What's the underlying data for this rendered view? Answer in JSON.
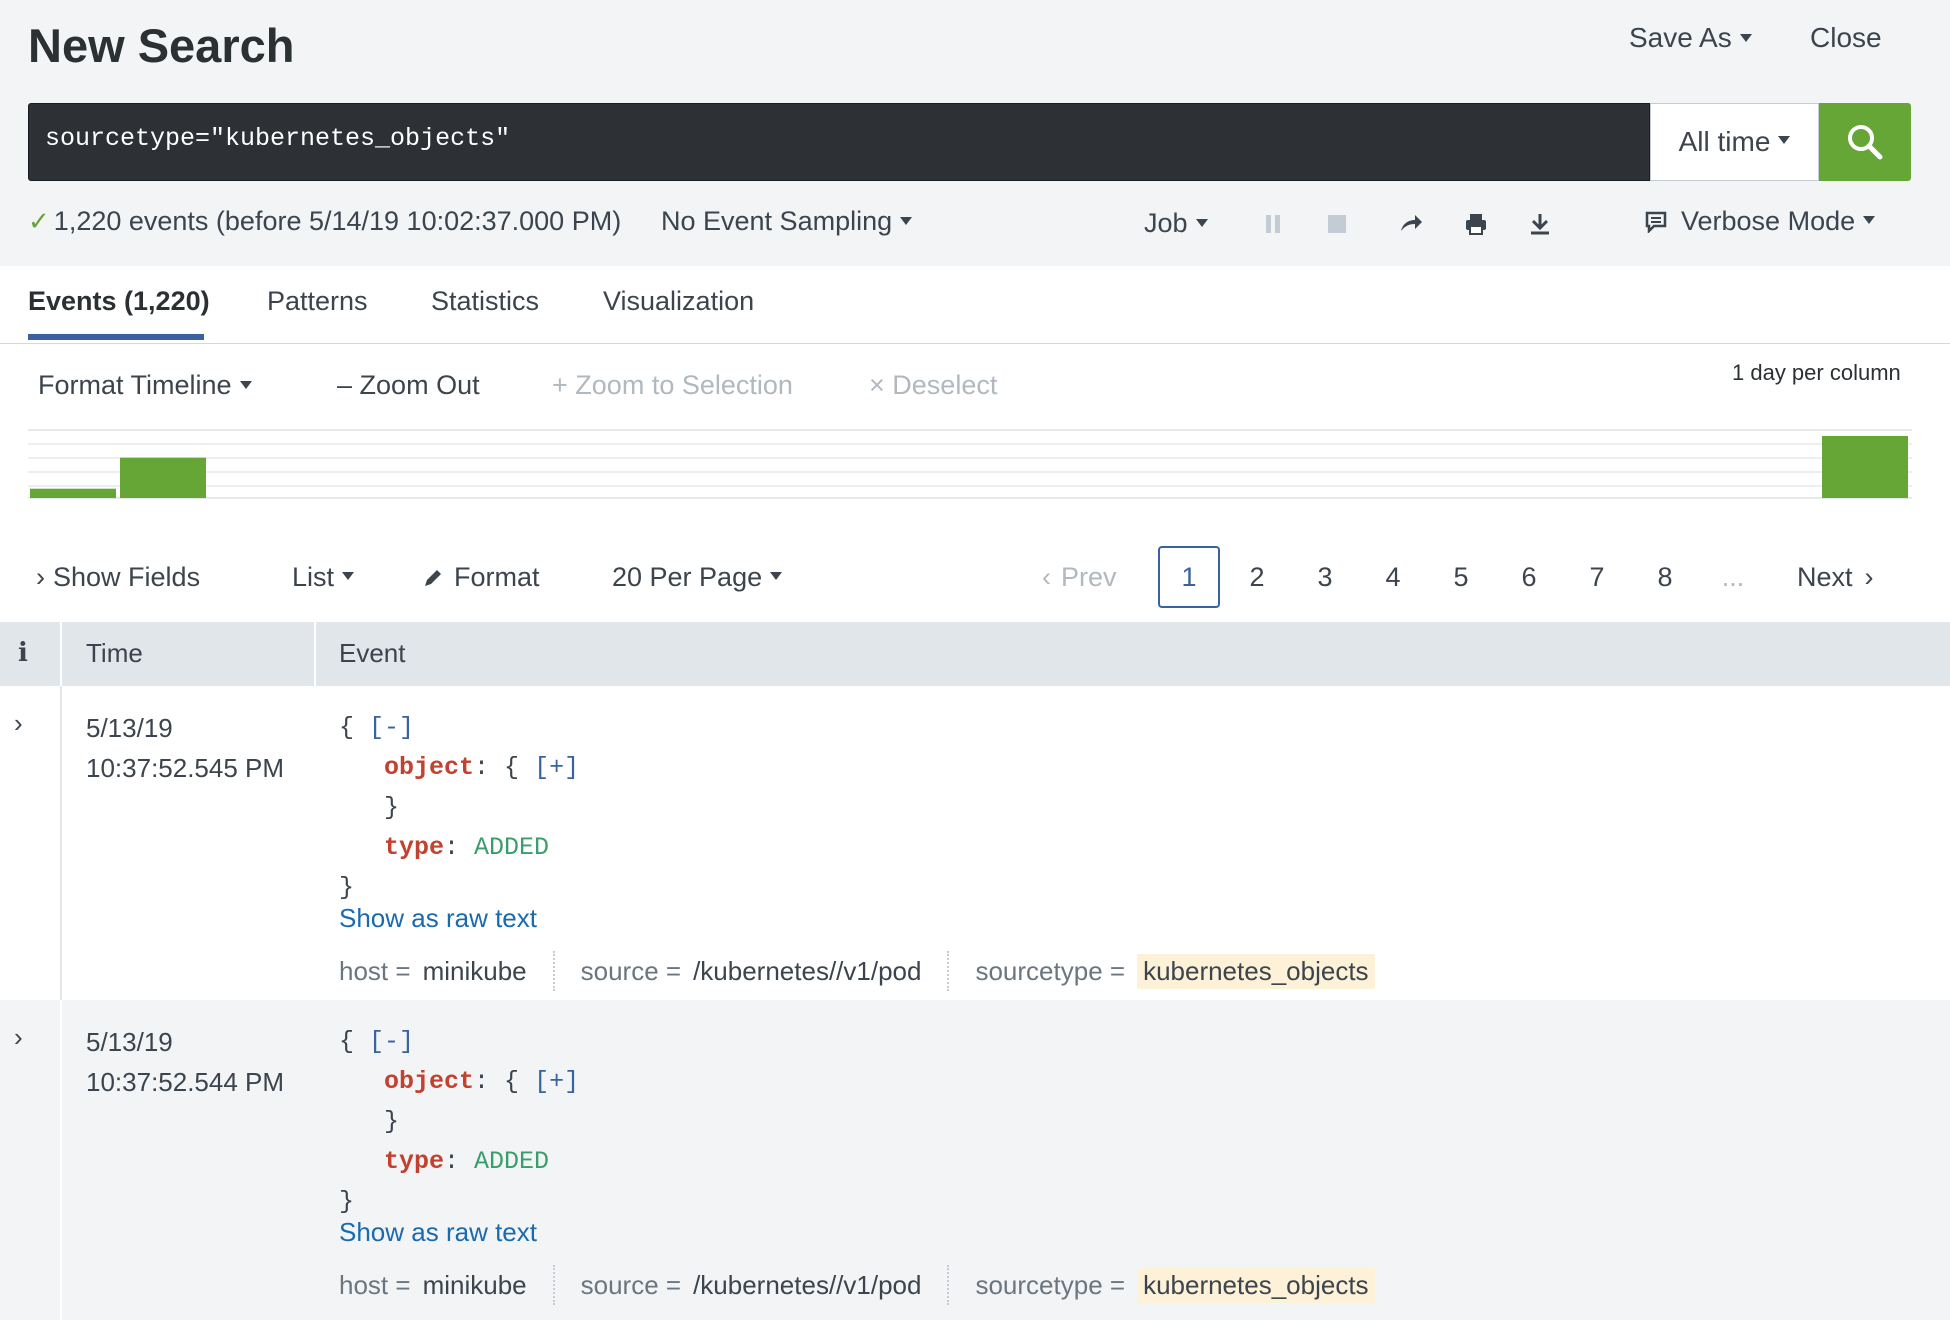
{
  "header": {
    "title": "New Search",
    "save_as": "Save As",
    "close": "Close"
  },
  "search": {
    "query": "sourcetype=\"kubernetes_objects\"",
    "time_range": "All time"
  },
  "status": {
    "events_summary": "1,220 events (before 5/14/19 10:02:37.000 PM)",
    "sampling": "No Event Sampling",
    "job": "Job",
    "mode": "Verbose Mode"
  },
  "tabs": [
    {
      "label": "Events (1,220)",
      "active": true
    },
    {
      "label": "Patterns"
    },
    {
      "label": "Statistics"
    },
    {
      "label": "Visualization"
    }
  ],
  "timeline_controls": {
    "format": "Format Timeline",
    "zoom_out": "Zoom Out",
    "zoom_selection": "Zoom to Selection",
    "deselect": "Deselect",
    "per_column": "1 day per column"
  },
  "timeline_bars": {
    "values": [
      0.15,
      0.65,
      1.0
    ],
    "color": "#65a637"
  },
  "results_toolbar": {
    "show_fields": "Show Fields",
    "list": "List",
    "format": "Format",
    "per_page": "20 Per Page",
    "prev": "Prev",
    "next": "Next",
    "pages": [
      "1",
      "2",
      "3",
      "4",
      "5",
      "6",
      "7",
      "8"
    ],
    "ellipsis": "...",
    "current_page": "1"
  },
  "table": {
    "col_info": "i",
    "col_time": "Time",
    "col_event": "Event"
  },
  "events": [
    {
      "date": "5/13/19",
      "time": "10:37:52.545 PM",
      "json_open": "{",
      "collapse": "[-]",
      "key_object": "object",
      "object_open": "{",
      "expand": "[+]",
      "object_close": "}",
      "key_type": "type",
      "type_value": "ADDED",
      "json_close": "}",
      "raw_link": "Show as raw text",
      "host_key": "host =",
      "host": "minikube",
      "source_key": "source =",
      "source": "/kubernetes//v1/pod",
      "sourcetype_key": "sourcetype =",
      "sourcetype": "kubernetes_objects"
    },
    {
      "date": "5/13/19",
      "time": "10:37:52.544 PM",
      "json_open": "{",
      "collapse": "[-]",
      "key_object": "object",
      "object_open": "{",
      "expand": "[+]",
      "object_close": "}",
      "key_type": "type",
      "type_value": "ADDED",
      "json_close": "}",
      "raw_link": "Show as raw text",
      "host_key": "host =",
      "host": "minikube",
      "source_key": "source =",
      "source": "/kubernetes//v1/pod",
      "sourcetype_key": "sourcetype =",
      "sourcetype": "kubernetes_objects"
    }
  ]
}
